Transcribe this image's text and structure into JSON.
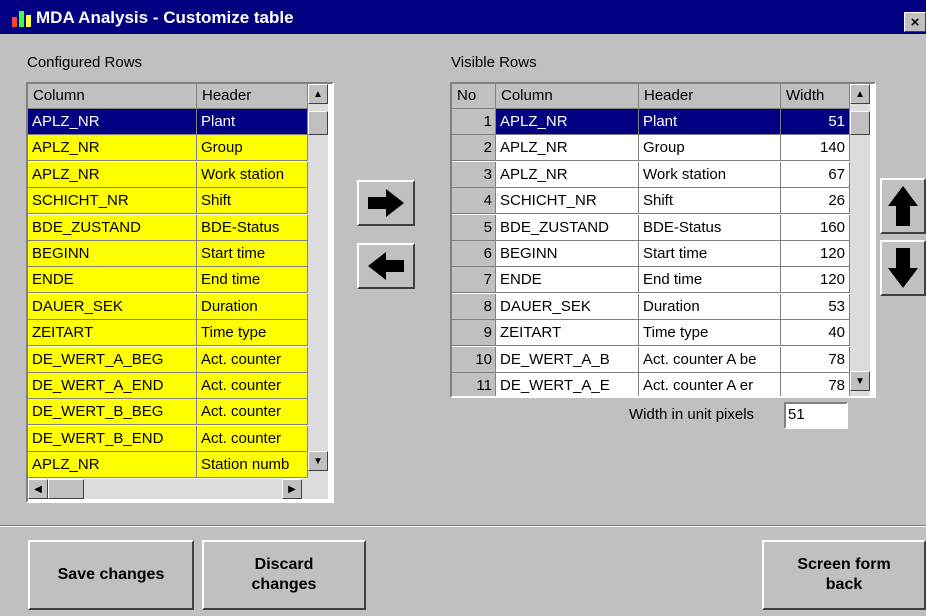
{
  "window": {
    "title": "MDA Analysis - Customize table",
    "close": "×",
    "icon": "bar-chart-icon"
  },
  "configured": {
    "label": "Configured Rows",
    "headers": [
      "Column",
      "Header"
    ],
    "rows": [
      {
        "column": "APLZ_NR",
        "header": "Plant"
      },
      {
        "column": "APLZ_NR",
        "header": "Group"
      },
      {
        "column": "APLZ_NR",
        "header": "Work station"
      },
      {
        "column": "SCHICHT_NR",
        "header": "Shift"
      },
      {
        "column": "BDE_ZUSTAND",
        "header": "BDE-Status"
      },
      {
        "column": "BEGINN",
        "header": "Start time"
      },
      {
        "column": "ENDE",
        "header": "End time"
      },
      {
        "column": "DAUER_SEK",
        "header": "Duration"
      },
      {
        "column": "ZEITART",
        "header": "Time type"
      },
      {
        "column": "DE_WERT_A_BEG",
        "header": "Act. counter"
      },
      {
        "column": "DE_WERT_A_END",
        "header": "Act. counter"
      },
      {
        "column": "DE_WERT_B_BEG",
        "header": "Act. counter"
      },
      {
        "column": "DE_WERT_B_END",
        "header": "Act. counter"
      },
      {
        "column": "APLZ_NR",
        "header": "Station numb"
      }
    ],
    "row_color": "#ffff00",
    "selected_index": 0
  },
  "visible": {
    "label": "Visible Rows",
    "headers": [
      "No",
      "Column",
      "Header",
      "Width"
    ],
    "rows": [
      {
        "no": "1",
        "column": "APLZ_NR",
        "header": "Plant",
        "width": "51"
      },
      {
        "no": "2",
        "column": "APLZ_NR",
        "header": "Group",
        "width": "140"
      },
      {
        "no": "3",
        "column": "APLZ_NR",
        "header": "Work station",
        "width": "67"
      },
      {
        "no": "4",
        "column": "SCHICHT_NR",
        "header": "Shift",
        "width": "26"
      },
      {
        "no": "5",
        "column": "BDE_ZUSTAND",
        "header": "BDE-Status",
        "width": "160"
      },
      {
        "no": "6",
        "column": "BEGINN",
        "header": "Start time",
        "width": "120"
      },
      {
        "no": "7",
        "column": "ENDE",
        "header": "End time",
        "width": "120"
      },
      {
        "no": "8",
        "column": "DAUER_SEK",
        "header": "Duration",
        "width": "53"
      },
      {
        "no": "9",
        "column": "ZEITART",
        "header": "Time type",
        "width": "40"
      },
      {
        "no": "10",
        "column": "DE_WERT_A_B",
        "header": "Act. counter A be",
        "width": "78"
      },
      {
        "no": "11",
        "column": "DE_WERT_A_E",
        "header": "Act. counter A er",
        "width": "78"
      }
    ],
    "selected_index": 0
  },
  "width_field": {
    "label": "Width in unit pixels",
    "value": "51"
  },
  "buttons": {
    "save": "Save changes",
    "discard_line1": "Discard",
    "discard_line2": "changes",
    "back_line1": "Screen form",
    "back_line2": "back"
  },
  "icons": {
    "move_right": "arrow-right-icon",
    "move_left": "arrow-left-icon",
    "move_up": "arrow-up-icon",
    "move_down": "arrow-down-icon"
  }
}
